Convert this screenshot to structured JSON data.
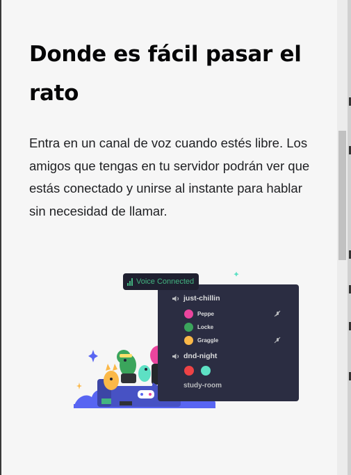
{
  "section": {
    "title": "Donde es fácil pasar el rato",
    "description": "Entra en un canal de voz cuando estés libre. Los amigos que tengas en tu servidor podrán ver que estás conectado y unirse al instante para hablar sin necesidad de llamar."
  },
  "illustration": {
    "voice_status": "Voice Connected",
    "channels": [
      {
        "name": "just-chillin",
        "users": [
          {
            "name": "Peppe",
            "muted": true
          },
          {
            "name": "Locke",
            "muted": false
          },
          {
            "name": "Graggle",
            "muted": true
          }
        ]
      },
      {
        "name": "dnd-night"
      }
    ],
    "room": "study-room"
  },
  "colors": {
    "accent_green": "#43b581",
    "panel_bg": "#2b2d42",
    "page_bg": "#f6f6f6"
  }
}
